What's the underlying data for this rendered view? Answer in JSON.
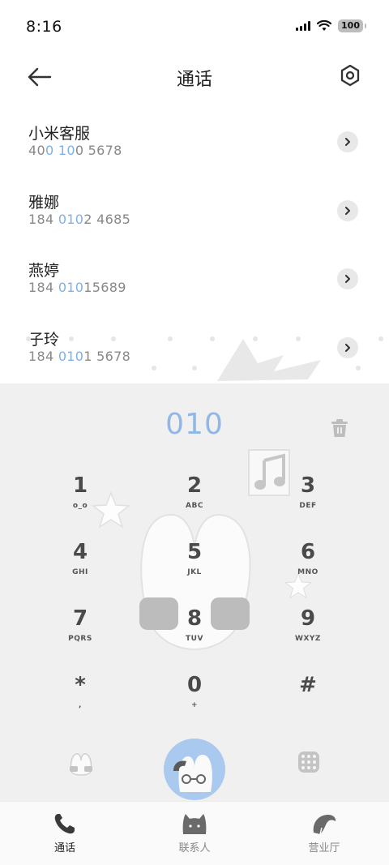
{
  "status_bar": {
    "time": "8:16",
    "battery": "100"
  },
  "header": {
    "title": "通话"
  },
  "contacts": [
    {
      "name": "小米客服",
      "number_parts": [
        {
          "t": "40",
          "h": false
        },
        {
          "t": "0",
          "h": true
        },
        {
          "t": " ",
          "h": false
        },
        {
          "t": "10",
          "h": true
        },
        {
          "t": "0 5678",
          "h": false
        }
      ]
    },
    {
      "name": "雅娜",
      "number_parts": [
        {
          "t": "184 ",
          "h": false
        },
        {
          "t": "010",
          "h": true
        },
        {
          "t": "2 4685",
          "h": false
        }
      ]
    },
    {
      "name": "燕婷",
      "number_parts": [
        {
          "t": "184 ",
          "h": false
        },
        {
          "t": "010",
          "h": true
        },
        {
          "t": "15689",
          "h": false
        }
      ]
    },
    {
      "name": "子玲",
      "number_parts": [
        {
          "t": "184 ",
          "h": false
        },
        {
          "t": "010",
          "h": true
        },
        {
          "t": "1 5678",
          "h": false
        }
      ]
    }
  ],
  "dialer": {
    "input": "010",
    "keys": [
      {
        "digit": "1",
        "letters": "o_o"
      },
      {
        "digit": "2",
        "letters": "ABC"
      },
      {
        "digit": "3",
        "letters": "DEF"
      },
      {
        "digit": "4",
        "letters": "GHI"
      },
      {
        "digit": "5",
        "letters": "JKL"
      },
      {
        "digit": "6",
        "letters": "MNO"
      },
      {
        "digit": "7",
        "letters": "PQRS"
      },
      {
        "digit": "8",
        "letters": "TUV"
      },
      {
        "digit": "9",
        "letters": "WXYZ"
      },
      {
        "digit": "*",
        "letters": ","
      },
      {
        "digit": "0",
        "letters": "+"
      },
      {
        "digit": "#",
        "letters": ""
      }
    ]
  },
  "bottom_nav": [
    {
      "label": "通话",
      "icon": "phone-icon",
      "active": true
    },
    {
      "label": "联系人",
      "icon": "contacts-cat-icon",
      "active": false
    },
    {
      "label": "营业厅",
      "icon": "service-hall-icon",
      "active": false
    }
  ],
  "colors": {
    "accent": "#8fb8e6",
    "highlight": "#7fb0e6",
    "panel_bg": "#f0f0f0",
    "call_button": "#a9c9ee"
  }
}
